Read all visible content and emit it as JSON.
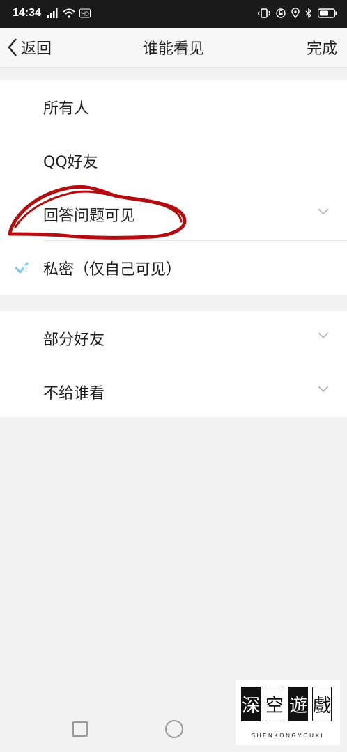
{
  "status_bar": {
    "time": "14:34",
    "left_icons": [
      "signal-icon",
      "wifi-icon",
      "hd-icon"
    ],
    "right_icons": [
      "vibrate-icon",
      "lock-icon",
      "location-icon",
      "bluetooth-icon",
      "battery-icon"
    ]
  },
  "nav": {
    "back_label": "返回",
    "title": "谁能看见",
    "done_label": "完成"
  },
  "options_group_1": [
    {
      "label": "所有人",
      "checked": false,
      "expandable": false
    },
    {
      "label": "QQ好友",
      "checked": false,
      "expandable": false
    },
    {
      "label": "回答问题可见",
      "checked": false,
      "expandable": true
    },
    {
      "label": "私密（仅自己可见）",
      "checked": true,
      "expandable": false
    }
  ],
  "options_group_2": [
    {
      "label": "部分好友",
      "expandable": true
    },
    {
      "label": "不给谁看",
      "expandable": true
    }
  ],
  "annotation": {
    "color": "#b40d10"
  },
  "watermark": {
    "chars": [
      "深",
      "空",
      "遊",
      "戲"
    ],
    "text": "SHENKONGYOUXI"
  },
  "colors": {
    "check": "#7ec8ee",
    "chevron": "#b8b8b8"
  }
}
